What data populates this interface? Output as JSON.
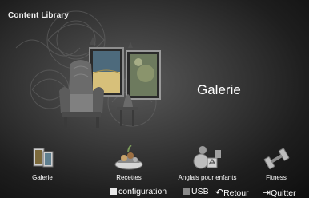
{
  "header": {
    "title": "Content Library"
  },
  "hero": {
    "section_title": "Galerie"
  },
  "menu": [
    {
      "label": "Galerie",
      "icon": "gallery-icon"
    },
    {
      "label": "Recettes",
      "icon": "recipes-icon"
    },
    {
      "label": "Anglais pour enfants",
      "icon": "children-english-icon"
    },
    {
      "label": "Fitness",
      "icon": "fitness-icon"
    }
  ],
  "footer": {
    "configuration": "configuration",
    "usb": "USB",
    "retour_glyph": "↶",
    "retour": "Retour",
    "quitter_glyph": "⇥",
    "quitter": "Quitter"
  },
  "colors": {
    "background": "#2e2e2e",
    "text": "#ffffff",
    "button_a": "#e8e8e8",
    "button_b": "#8a8a8a"
  }
}
